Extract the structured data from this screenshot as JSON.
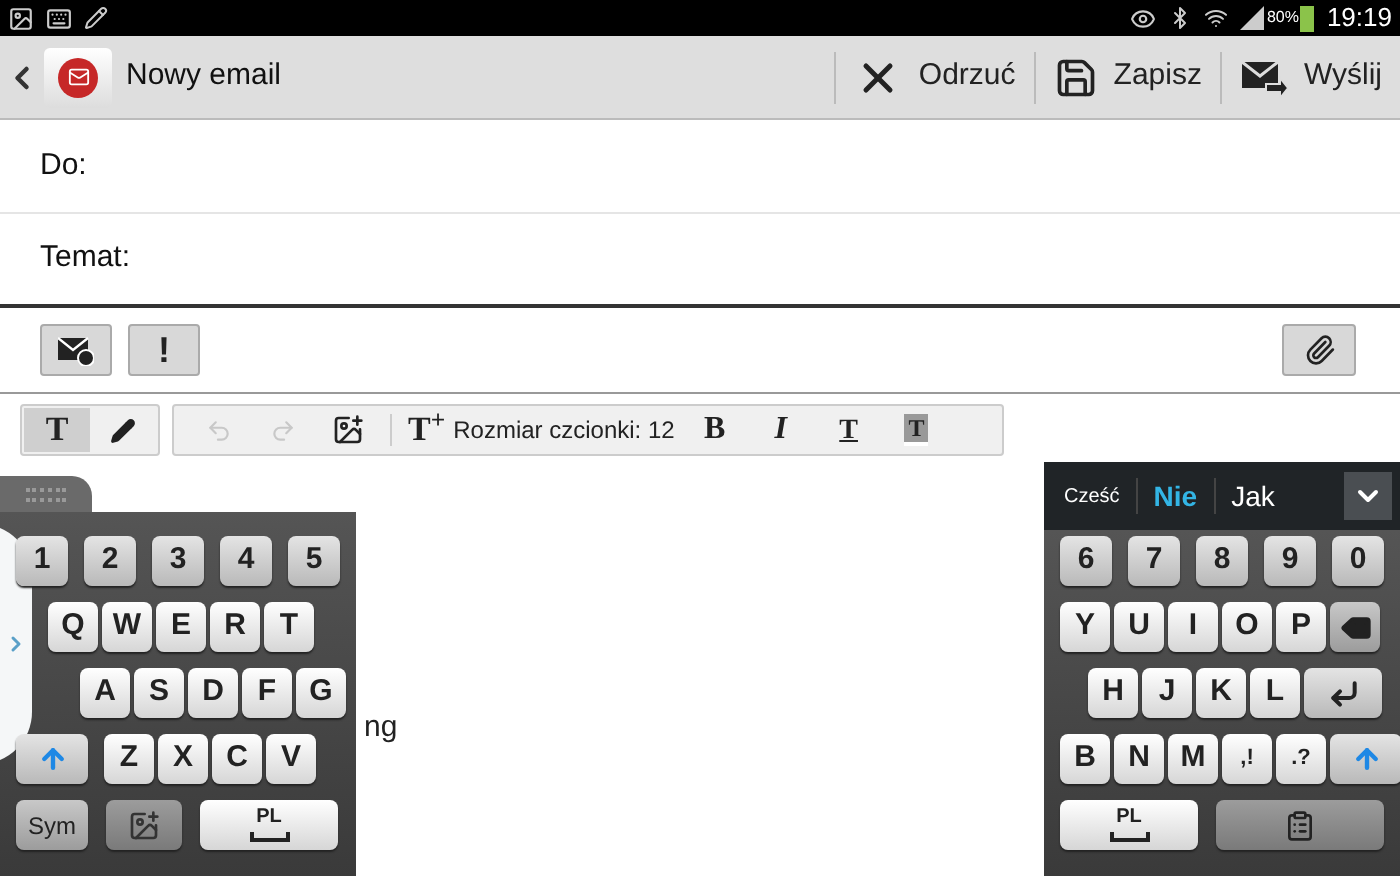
{
  "status_bar": {
    "battery": "80%",
    "time": "19:19"
  },
  "action_bar": {
    "title": "Nowy email",
    "actions": [
      {
        "kind": "discard",
        "label": "Odrzuć"
      },
      {
        "kind": "save",
        "label": "Zapisz"
      },
      {
        "kind": "send",
        "label": "Wyślij"
      }
    ]
  },
  "fields": [
    {
      "label": "Do:"
    },
    {
      "label": "Temat:"
    }
  ],
  "options": [
    {
      "kind": "schedule"
    },
    {
      "kind": "priority",
      "label": "!"
    }
  ],
  "format_toolbar": {
    "modes": [
      {
        "kind": "text",
        "label": "T",
        "selected": true
      },
      {
        "kind": "pen",
        "selected": false
      }
    ],
    "tools": [
      {
        "kind": "undo",
        "disabled": true
      },
      {
        "kind": "redo",
        "disabled": true
      },
      {
        "kind": "image",
        "disabled": false
      },
      {
        "kind": "size-up",
        "label": "T$^{+}$",
        "disabled": false
      },
      {
        "kind": "size",
        "label": "Rozmiar czcionki: 12",
        "disabled": false
      },
      {
        "kind": "bold",
        "label": "B",
        "disabled": false
      },
      {
        "kind": "italic",
        "label": "I",
        "disabled": false
      },
      {
        "kind": "underline",
        "label": "T",
        "disabled": false
      },
      {
        "kind": "highlight",
        "label": "T",
        "disabled": false
      }
    ]
  },
  "body": {
    "text": "ng"
  },
  "keyboard_left": {
    "rows": [
      [
        {
          "kind": "number",
          "label": "1"
        },
        {
          "kind": "number",
          "label": "2"
        },
        {
          "kind": "number",
          "label": "3"
        },
        {
          "kind": "number",
          "label": "4"
        },
        {
          "kind": "number",
          "label": "5"
        }
      ],
      [
        {
          "kind": "letter",
          "label": "Q"
        },
        {
          "kind": "letter",
          "label": "W"
        },
        {
          "kind": "letter",
          "label": "E"
        },
        {
          "kind": "letter",
          "label": "R"
        },
        {
          "kind": "letter",
          "label": "T"
        }
      ],
      [
        {
          "kind": "letter",
          "label": "A"
        },
        {
          "kind": "letter",
          "label": "S"
        },
        {
          "kind": "letter",
          "label": "D"
        },
        {
          "kind": "letter",
          "label": "F"
        },
        {
          "kind": "letter",
          "label": "G"
        }
      ],
      [
        {
          "kind": "shift"
        },
        {
          "kind": "letter",
          "label": "Z"
        },
        {
          "kind": "letter",
          "label": "X"
        },
        {
          "kind": "letter",
          "label": "C"
        },
        {
          "kind": "letter",
          "label": "V"
        }
      ],
      [
        {
          "kind": "sym",
          "label": "Sym"
        },
        {
          "kind": "media"
        },
        {
          "kind": "space",
          "label": "PL"
        }
      ]
    ]
  },
  "keyboard_right": {
    "suggestions": [
      {
        "label": "Cześć",
        "selected": false
      },
      {
        "label": "Nie",
        "selected": true
      },
      {
        "label": "Jak",
        "selected": false
      }
    ],
    "rows": [
      [
        {
          "kind": "number",
          "label": "6"
        },
        {
          "kind": "number",
          "label": "7"
        },
        {
          "kind": "number",
          "label": "8"
        },
        {
          "kind": "number",
          "label": "9"
        },
        {
          "kind": "number",
          "label": "0"
        }
      ],
      [
        {
          "kind": "letter",
          "label": "Y"
        },
        {
          "kind": "letter",
          "label": "U"
        },
        {
          "kind": "letter",
          "label": "I"
        },
        {
          "kind": "letter",
          "label": "O"
        },
        {
          "kind": "letter",
          "label": "P"
        },
        {
          "kind": "backspace"
        }
      ],
      [
        {
          "kind": "letter",
          "label": "H"
        },
        {
          "kind": "letter",
          "label": "J"
        },
        {
          "kind": "letter",
          "label": "K"
        },
        {
          "kind": "letter",
          "label": "L"
        },
        {
          "kind": "enter"
        }
      ],
      [
        {
          "kind": "letter",
          "label": "B"
        },
        {
          "kind": "letter",
          "label": "N"
        },
        {
          "kind": "letter",
          "label": "M"
        },
        {
          "kind": "punct",
          "label": ",",
          "alt": "!"
        },
        {
          "kind": "punct",
          "label": ".",
          "alt": "?"
        },
        {
          "kind": "shift"
        }
      ],
      [
        {
          "kind": "space",
          "label": "PL"
        },
        {
          "kind": "clipboard"
        }
      ]
    ]
  }
}
